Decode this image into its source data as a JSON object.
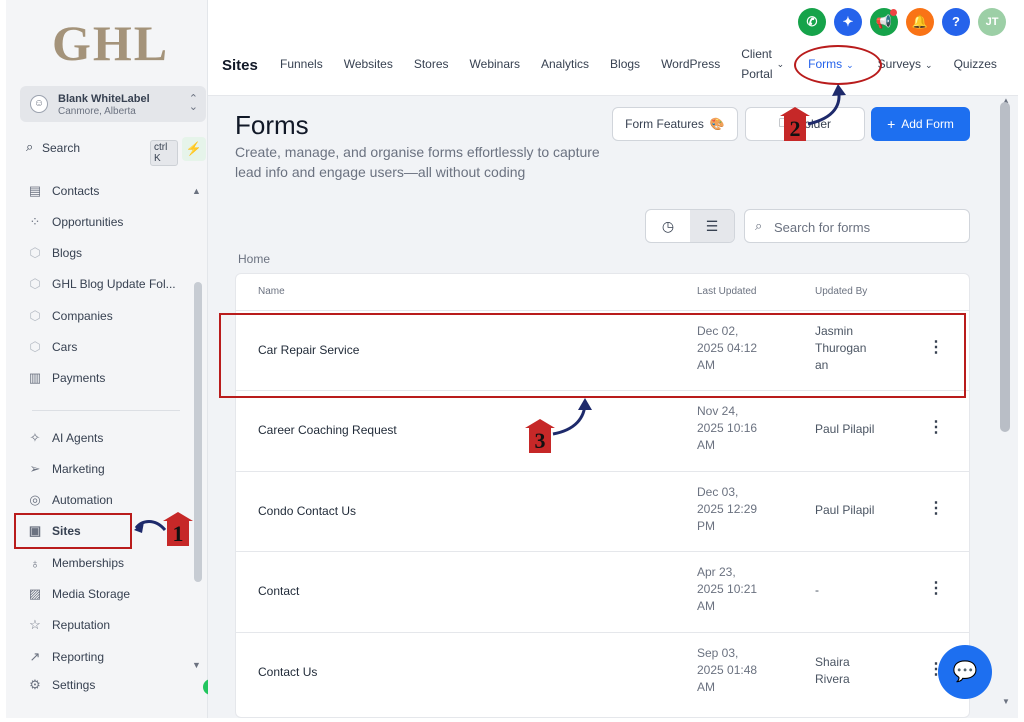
{
  "sidebar": {
    "logo": "GHL",
    "account": {
      "name": "Blank WhiteLabel",
      "location": "Canmore, Alberta"
    },
    "search": {
      "label": "Search",
      "shortcut": "ctrl K"
    },
    "items": [
      {
        "label": "Contacts",
        "icon": "contacts-icon"
      },
      {
        "label": "Opportunities",
        "icon": "opportunities-icon"
      },
      {
        "label": "Blogs",
        "icon": "cube-icon"
      },
      {
        "label": "GHL Blog Update Fol...",
        "icon": "cube-icon"
      },
      {
        "label": "Companies",
        "icon": "cube-icon"
      },
      {
        "label": "Cars",
        "icon": "cube-icon"
      },
      {
        "label": "Payments",
        "icon": "payments-icon"
      },
      {
        "label": "AI Agents",
        "icon": "sparkle-icon"
      },
      {
        "label": "Marketing",
        "icon": "send-icon"
      },
      {
        "label": "Automation",
        "icon": "automation-icon"
      },
      {
        "label": "Sites",
        "icon": "sites-icon"
      },
      {
        "label": "Memberships",
        "icon": "badge-icon"
      },
      {
        "label": "Media Storage",
        "icon": "image-icon"
      },
      {
        "label": "Reputation",
        "icon": "star-icon"
      },
      {
        "label": "Reporting",
        "icon": "trend-icon"
      },
      {
        "label": "Settings",
        "icon": "gear-icon"
      }
    ]
  },
  "header": {
    "section_title": "Sites",
    "tabs": [
      {
        "label": "Funnels"
      },
      {
        "label": "Websites"
      },
      {
        "label": "Stores"
      },
      {
        "label": "Webinars"
      },
      {
        "label": "Analytics"
      },
      {
        "label": "Blogs"
      },
      {
        "label": "WordPress"
      },
      {
        "label_line1": "Client",
        "label_line2": "Portal"
      },
      {
        "label": "Forms",
        "active": true
      },
      {
        "label": "Surveys"
      },
      {
        "label": "Quizzes"
      }
    ],
    "icons": [
      {
        "name": "phone-icon",
        "color": "#16a34a"
      },
      {
        "name": "ai-sparkle-icon",
        "color": "#2563eb"
      },
      {
        "name": "megaphone-icon",
        "color": "#16a34a"
      },
      {
        "name": "bell-icon",
        "color": "#f97316"
      },
      {
        "name": "help-icon",
        "color": "#2563eb"
      }
    ],
    "avatar_initials": "JT"
  },
  "page": {
    "title": "Forms",
    "subtitle": "Create, manage, and organise forms effortlessly to capture lead info and engage users—all without coding",
    "buttons": {
      "features": "Form Features",
      "folder": "Folder",
      "add": "Add Form"
    },
    "search_placeholder": "Search for forms",
    "breadcrumb": "Home"
  },
  "table": {
    "columns": {
      "name": "Name",
      "updated": "Last Updated",
      "by": "Updated By"
    },
    "rows": [
      {
        "name": "Car Repair Service",
        "date_l1": "Dec 02,",
        "date_l2": "2025 04:12",
        "date_l3": "AM",
        "by_l1": "Jasmin",
        "by_l2": "Thurogan",
        "by_l3": "an"
      },
      {
        "name": "Career Coaching Request",
        "date_l1": "Nov 24,",
        "date_l2": "2025 10:16",
        "date_l3": "AM",
        "by_l1": "Paul Pilapil"
      },
      {
        "name": "Condo Contact Us",
        "date_l1": "Dec 03,",
        "date_l2": "2025 12:29",
        "date_l3": "PM",
        "by_l1": "Paul Pilapil"
      },
      {
        "name": "Contact",
        "date_l1": "Apr 23,",
        "date_l2": "2025 10:21",
        "date_l3": "AM",
        "by_l1": "-"
      },
      {
        "name": "Contact Us",
        "date_l1": "Sep 03,",
        "date_l2": "2025 01:48",
        "date_l3": "AM",
        "by_l1": "Shaira",
        "by_l2": "Rivera"
      }
    ]
  },
  "annotations": {
    "step1": "1",
    "step2": "2",
    "step3": "3"
  },
  "colors": {
    "accent": "#1d6ff0",
    "annotation": "#b91c1c",
    "logo": "#a4937a"
  }
}
